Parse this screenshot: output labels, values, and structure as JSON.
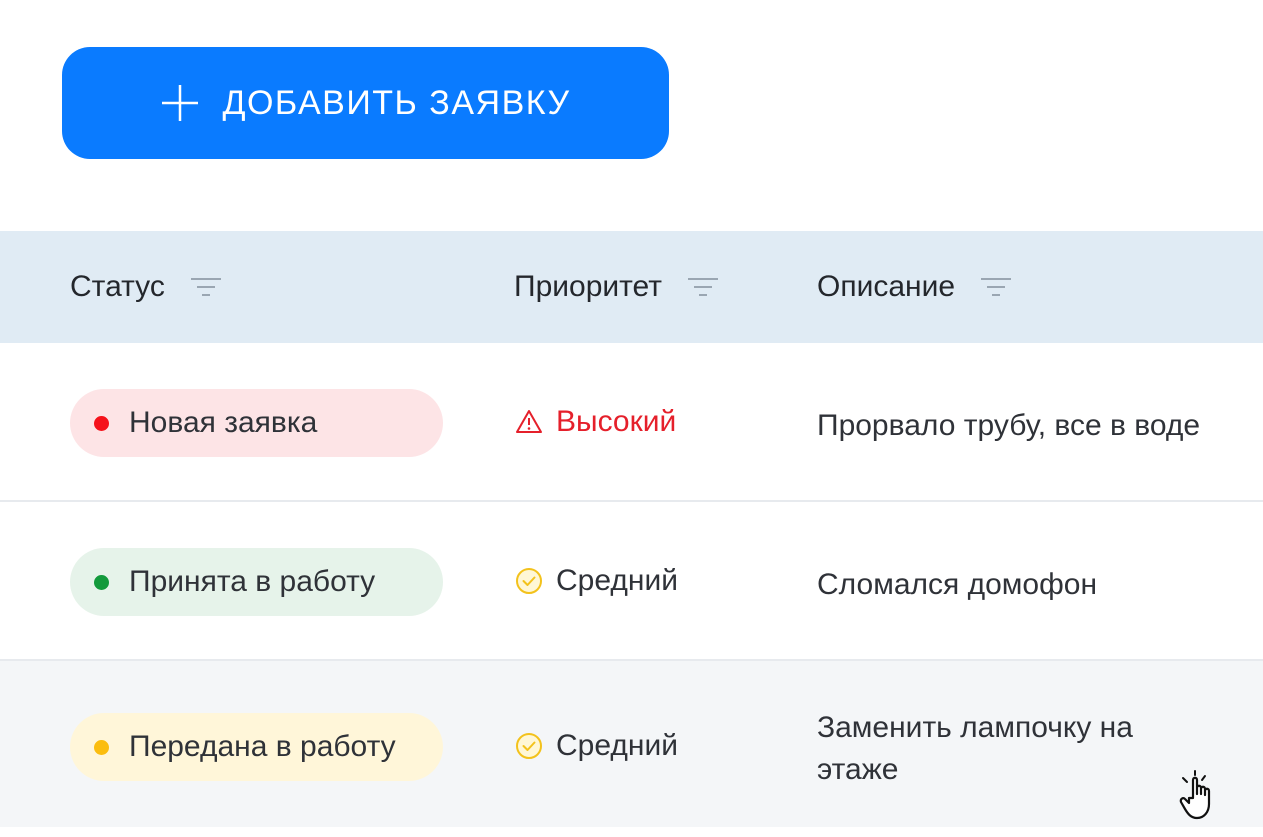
{
  "add_button": {
    "label": "ДОБАВИТЬ ЗАЯВКУ",
    "icon": "plus-icon"
  },
  "table": {
    "columns": [
      {
        "label": "Статус",
        "icon": "filter-icon"
      },
      {
        "label": "Приоритет",
        "icon": "filter-icon"
      },
      {
        "label": "Описание",
        "icon": "filter-icon"
      }
    ],
    "rows": [
      {
        "status": "Новая заявка",
        "priority": "Высокий",
        "priority_icon": "warning-triangle-icon",
        "description": "Прорвало трубу, все в воде"
      },
      {
        "status": "Принята в работу",
        "priority": "Средний",
        "priority_icon": "check-circle-icon",
        "description": "Сломался домофон"
      },
      {
        "status": "Передана в работу",
        "priority": "Средний",
        "priority_icon": "check-circle-icon",
        "description": "Заменить лампочку на этаже"
      }
    ]
  },
  "colors": {
    "accent": "#0a7bff",
    "header_bg": "#e0ebf4",
    "status_new_bg": "#fde4e6",
    "status_new_dot": "#f5121b",
    "status_accepted_bg": "#e6f3ea",
    "status_accepted_dot": "#139a3c",
    "status_transferred_bg": "#fff6d9",
    "status_transferred_dot": "#fbbd0f",
    "priority_high": "#e5202b",
    "priority_medium_icon": "#f3c21c"
  },
  "cursor": "pointer-hand-icon"
}
